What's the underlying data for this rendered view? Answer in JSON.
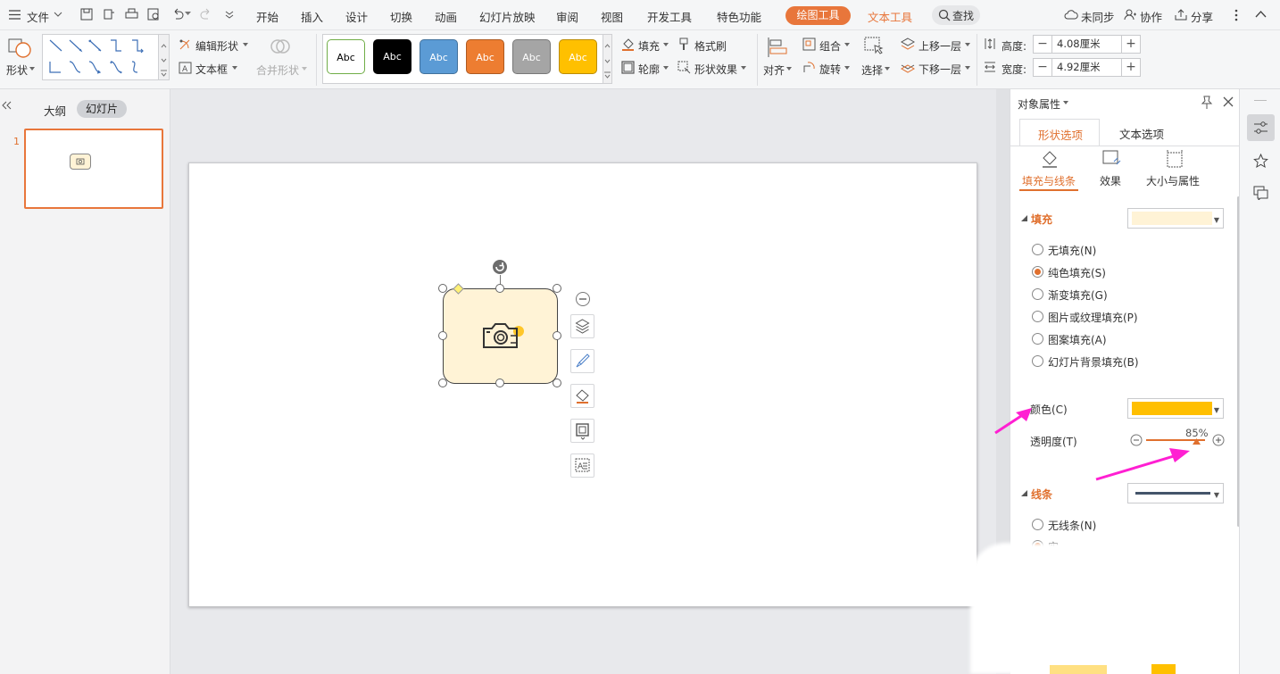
{
  "menubar": {
    "file": "文件",
    "tabs": [
      "开始",
      "插入",
      "设计",
      "切换",
      "动画",
      "幻灯片放映",
      "审阅",
      "视图",
      "开发工具",
      "特色功能"
    ],
    "drawing_tools": "绘图工具",
    "text_tools": "文本工具",
    "search": "查找",
    "sync": "未同步",
    "collab": "协作",
    "share": "分享"
  },
  "ribbon": {
    "shape": "形状",
    "edit_shape": "编辑形状",
    "text_box": "文本框",
    "merge_shape": "合并形状",
    "style_sample": "Abc",
    "fill": "填充",
    "format_painter": "格式刷",
    "outline": "轮廓",
    "shape_effect": "形状效果",
    "align": "对齐",
    "group": "组合",
    "rotate": "旋转",
    "select": "选择",
    "bring_forward": "上移一层",
    "send_backward": "下移一层",
    "height_label": "高度:",
    "height_value": "4.08厘米",
    "width_label": "宽度:",
    "width_value": "4.92厘米"
  },
  "left_panel": {
    "tab_outline": "大纲",
    "tab_slides": "幻灯片",
    "slide_number": "1"
  },
  "right_panel": {
    "title": "对象属性",
    "tab_shape": "形状选项",
    "tab_text": "文本选项",
    "sub_fill_line": "填充与线条",
    "sub_effect": "效果",
    "sub_size": "大小与属性",
    "fill_section": "填充",
    "fill_options": [
      "无填充(N)",
      "纯色填充(S)",
      "渐变填充(G)",
      "图片或纹理填充(P)",
      "图案填充(A)",
      "幻灯片背景填充(B)"
    ],
    "selected_fill": 1,
    "color_label": "颜色(C)",
    "transparency_label": "透明度(T)",
    "transparency_value": "85%",
    "transparency_level": 0.85,
    "line_section": "线条",
    "line_options": [
      "无线条(N)",
      "实"
    ]
  },
  "colors": {
    "accent": "#e8763b",
    "fill_preview": "#fff3d6",
    "color_swatch": "#ffbf00",
    "annotation_arrow": "#ff1fd2",
    "line_preview": "#44546a"
  }
}
